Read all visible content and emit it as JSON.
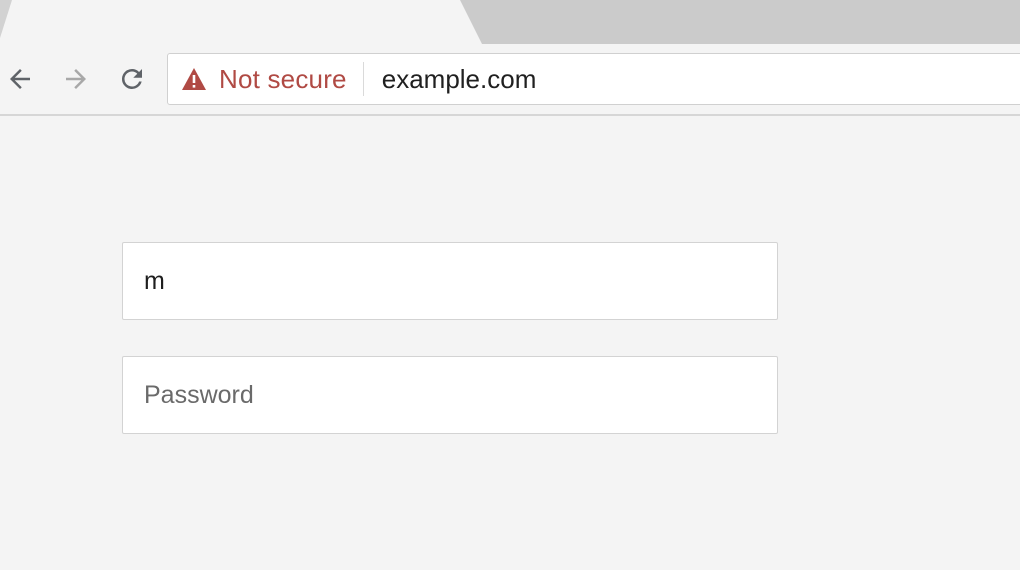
{
  "browser": {
    "nav": {
      "back_icon": "arrow-left-icon",
      "forward_icon": "arrow-right-icon",
      "reload_icon": "reload-icon"
    },
    "omnibox": {
      "security_icon": "warning-triangle-icon",
      "security_label": "Not secure",
      "url": "example.com"
    },
    "colors": {
      "security_warning": "#b04a44",
      "inactive_tab": "#cbcbcb",
      "page_background": "#f4f4f4"
    }
  },
  "form": {
    "username": {
      "value": "m"
    },
    "password": {
      "placeholder": "Password",
      "value": ""
    }
  }
}
